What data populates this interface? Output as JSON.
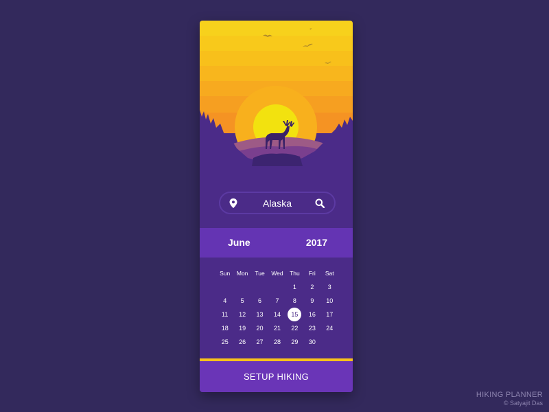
{
  "search": {
    "location": "Alaska"
  },
  "calendar": {
    "month": "June",
    "year": "2017",
    "weekdays": [
      "Sun",
      "Mon",
      "Tue",
      "Wed",
      "Thu",
      "Fri",
      "Sat"
    ],
    "weeks": [
      [
        "",
        "",
        "",
        "",
        "1",
        "2",
        "3"
      ],
      [
        "4",
        "5",
        "6",
        "7",
        "8",
        "9",
        "10"
      ],
      [
        "11",
        "12",
        "13",
        "14",
        "15",
        "16",
        "17"
      ],
      [
        "18",
        "19",
        "20",
        "21",
        "22",
        "23",
        "24"
      ],
      [
        "25",
        "26",
        "27",
        "28",
        "29",
        "30",
        ""
      ]
    ],
    "selected_day": "15"
  },
  "cta": {
    "label": "SETUP HIKING"
  },
  "credit": {
    "title": "HIKING PLANNER",
    "author": "© Satyajit Das"
  },
  "colors": {
    "background": "#33295c",
    "card": "#4b2b88",
    "accent": "#6434b3",
    "sun": "#f2e20f",
    "highlight": "#f9c21b"
  }
}
